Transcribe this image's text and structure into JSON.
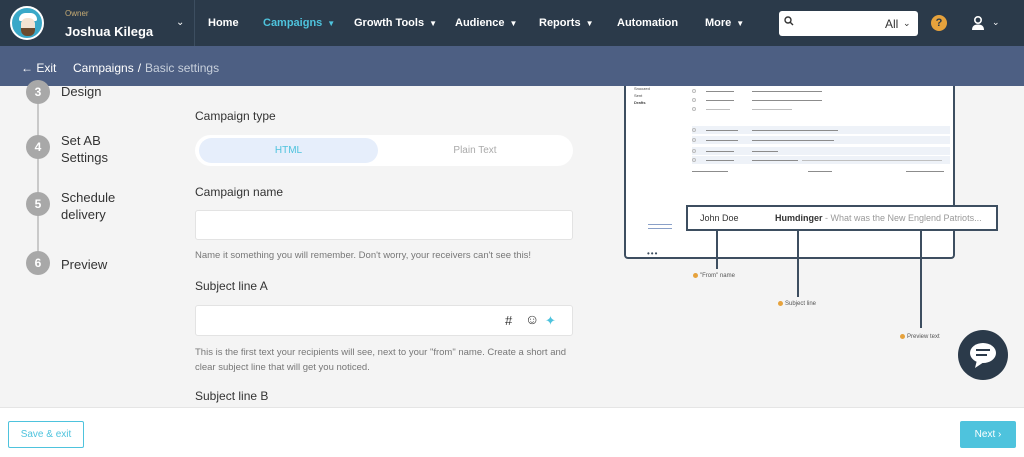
{
  "header": {
    "role": "Owner",
    "user_name": "Joshua Kilega",
    "nav": [
      {
        "label": "Home",
        "caret": false
      },
      {
        "label": "Campaigns",
        "caret": true,
        "active": true
      },
      {
        "label": "Growth Tools",
        "caret": true
      },
      {
        "label": "Audience",
        "caret": true
      },
      {
        "label": "Reports",
        "caret": true
      },
      {
        "label": "Automation",
        "caret": false
      },
      {
        "label": "More",
        "caret": true
      }
    ],
    "search": {
      "placeholder": "",
      "scope": "All"
    },
    "help_label": "?",
    "icons": {
      "search": "search-icon",
      "help": "help-icon",
      "user": "user-icon",
      "caret": "chevron-down-icon"
    }
  },
  "subbar": {
    "exit_label": "Exit",
    "breadcrumb": {
      "parent": "Campaigns",
      "separator": "/",
      "current": "Basic settings"
    }
  },
  "steps": [
    {
      "number": "3",
      "label": "Design"
    },
    {
      "number": "4",
      "label": "Set AB Settings"
    },
    {
      "number": "5",
      "label": "Schedule delivery"
    },
    {
      "number": "6",
      "label": "Preview"
    }
  ],
  "form": {
    "campaign_type_label": "Campaign type",
    "campaign_type_options": [
      "HTML",
      "Plain Text"
    ],
    "campaign_type_selected": "HTML",
    "campaign_name_label": "Campaign name",
    "campaign_name_value": "",
    "campaign_name_help": "Name it something you will remember. Don't worry, your receivers can't see this!",
    "subject_a_label": "Subject line A",
    "subject_a_value": "",
    "subject_a_help": "This is the first text your recipients will see, next to your \"from\" name. Create a short and clear subject line that will get you noticed.",
    "subject_b_label": "Subject line B",
    "subject_tools": {
      "hashtag": "#",
      "emoji": "☺",
      "ai": "✦"
    }
  },
  "preview": {
    "sidebar_items": [
      "Snoozed",
      "Sent",
      "Drafts"
    ],
    "email": {
      "from_name": "John Doe",
      "subject": "Humdinger",
      "preview_text": "- What was the New Englend Patriots..."
    },
    "callouts": {
      "from": "\"From\" name",
      "subject": "Subject line",
      "preview": "Preview text"
    }
  },
  "footer": {
    "save_exit_label": "Save & exit",
    "next_label": "Next"
  },
  "colors": {
    "nav_bg": "#2b3a4a",
    "subbar_bg": "#4d5f83",
    "accent": "#4ec3dd",
    "warning": "#e6a23c"
  }
}
